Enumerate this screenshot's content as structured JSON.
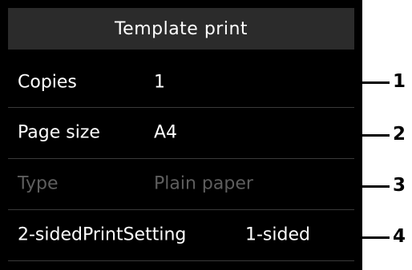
{
  "screen": {
    "title": "Template print",
    "settings": [
      {
        "label": "Copies",
        "value": "1",
        "enabled": true
      },
      {
        "label": "Page size",
        "value": "A4",
        "enabled": true
      },
      {
        "label": "Type",
        "value": "Plain paper",
        "enabled": false
      },
      {
        "label": "2-sidedPrintSetting",
        "value": "1-sided",
        "enabled": true
      }
    ]
  },
  "callouts": [
    "1",
    "2",
    "3",
    "4"
  ],
  "colors": {
    "screen_background": "#000000",
    "title_background": "#2b2b2b",
    "text": "#ffffff",
    "disabled_text": "#5e5e5e",
    "page_background": "#ffffff"
  }
}
